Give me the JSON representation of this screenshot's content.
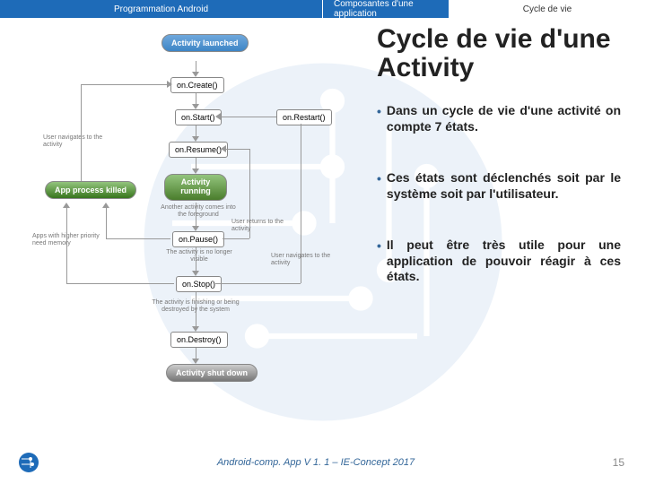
{
  "header": {
    "left": "Programmation Android",
    "mid": "Composantes d'une application",
    "right": "Cycle de vie"
  },
  "title": "Cycle de vie d'une Activity",
  "bullets": [
    "Dans un cycle de vie d'une activité on compte 7 états.",
    "Ces états sont déclenchés soit par le système soit par l'utilisateur.",
    "Il peut être très utile pour une application de pouvoir réagir à ces états."
  ],
  "footer": {
    "text": "Android-comp. App V 1. 1 – IE-Concept 2017",
    "page": "15"
  },
  "diagram": {
    "launched": "Activity launched",
    "onCreate": "on.Create()",
    "onStart": "on.Start()",
    "onResume": "on.Resume()",
    "running": "Activity running",
    "onPause": "on.Pause()",
    "onStop": "on.Stop()",
    "onDestroy": "on.Destroy()",
    "onRestart": "on.Restart()",
    "shutdown": "Activity shut down",
    "killed": "App process killed",
    "navBack": "User navigates to the activity",
    "another": "Another activity comes into the foreground",
    "returns": "User returns to the activity",
    "noLonger": "The activity is no longer visible",
    "userNav": "User navigates to the activity",
    "prio": "Apps with higher priority need memory",
    "finishing": "The activity is finishing or being destroyed by the system"
  }
}
